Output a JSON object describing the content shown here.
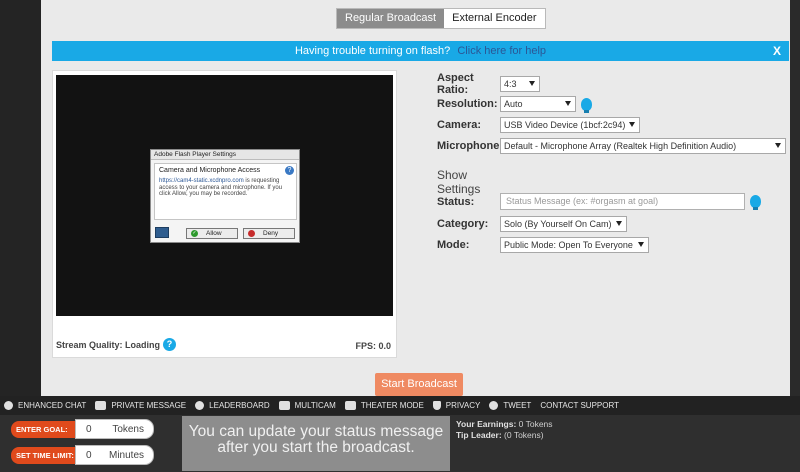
{
  "tabs": [
    "Regular Broadcast",
    "External Encoder"
  ],
  "flash_notice": {
    "message": "Having trouble turning on flash?",
    "link": "Click here for help",
    "close": "X"
  },
  "preview": {
    "stream_quality_label": "Stream Quality:",
    "stream_quality_value": "Loading",
    "fps": "FPS: 0.0",
    "flash_dialog": {
      "title": "Adobe Flash Player Settings",
      "heading": "Camera and Microphone Access",
      "help_icon": "?",
      "link": "https://cam4-static.xcdnpro.com",
      "text": " is requesting access to your camera and microphone. If you click Allow, you may be recorded.",
      "allow": "Allow",
      "deny": "Deny"
    }
  },
  "settings": {
    "aspect_ratio": {
      "label": "Aspect Ratio:",
      "value": "4:3"
    },
    "resolution": {
      "label": "Resolution:",
      "value": "Auto"
    },
    "camera": {
      "label": "Camera:",
      "value": "USB Video Device (1bcf:2c94)"
    },
    "microphone": {
      "label": "Microphone:",
      "value": "Default - Microphone Array (Realtek High Definition Audio)"
    },
    "show_settings_title": "Show Settings",
    "status": {
      "label": "Status:",
      "placeholder": "Status Message (ex: #orgasm at goal)"
    },
    "category": {
      "label": "Category:",
      "value": "Solo (By Yourself On Cam)"
    },
    "mode": {
      "label": "Mode:",
      "value": "Public Mode: Open To Everyone"
    }
  },
  "start_button": "Start Broadcast",
  "toolbar": [
    {
      "label": "Enhanced Chat",
      "icon": "chat-bubble-icon"
    },
    {
      "label": "Private Message",
      "icon": "envelope-icon"
    },
    {
      "label": "Leaderboard",
      "icon": "medal-icon"
    },
    {
      "label": "Multicam",
      "icon": "multicam-icon"
    },
    {
      "label": "Theater Mode",
      "icon": "expand-icon"
    },
    {
      "label": "Privacy",
      "icon": "shield-icon"
    },
    {
      "label": "Tweet",
      "icon": "twitter-bird-icon"
    },
    {
      "label": "Contact Support",
      "icon": ""
    }
  ],
  "goal": {
    "label": "ENTER GOAL:",
    "value": "0",
    "unit": "Tokens"
  },
  "time_limit": {
    "label": "SET TIME LIMIT:",
    "value": "0",
    "unit": "Minutes"
  },
  "status_hint": "You can update your status message after you start the broadcast.",
  "earnings": {
    "label": "Your Earnings:",
    "value": "0 Tokens"
  },
  "tip_leader": {
    "label": "Tip Leader:",
    "value": "(0 Tokens)"
  }
}
